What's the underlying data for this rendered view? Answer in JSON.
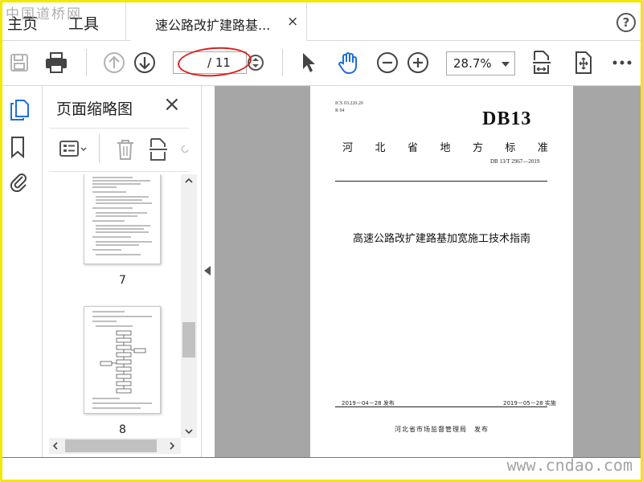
{
  "watermarks": {
    "top": "中国道桥网",
    "bottom": "www.cndao.com"
  },
  "tabs": {
    "home": "主页",
    "tools": "工具",
    "document": "速公路改扩建路基...",
    "close": "×"
  },
  "help": {
    "label": "?"
  },
  "toolbar": {
    "page_current": "",
    "page_total": "/ 11",
    "zoom": "28.7%",
    "icons": [
      "save-icon",
      "print-icon",
      "page-up-icon",
      "page-down-icon",
      "stepper-icon",
      "select-icon",
      "hand-icon",
      "zoom-out-icon",
      "zoom-in-icon",
      "fit-page-icon",
      "scroll-mode-icon",
      "more-icon"
    ]
  },
  "thumbnails_panel": {
    "title": "页面缩略图",
    "close": "×",
    "pages": [
      {
        "number": "7"
      },
      {
        "number": "8"
      }
    ]
  },
  "document": {
    "meta": [
      "ICS 03.220.20",
      "R 04"
    ],
    "standard_prefix": "DB13",
    "province": [
      "河",
      "北",
      "省",
      "地",
      "方",
      "标",
      "准"
    ],
    "code": "DB 13/T 2967—2019",
    "title": "高速公路改扩建路基加宽施工技术指南",
    "release_date": "2019－04－28 发布",
    "implement_date": "2019－05－28 实施",
    "issuer": "河北省市场监督管理局　发布"
  },
  "colors": {
    "frame": "#f5e600",
    "annotation_oval": "#d9231e",
    "viewport_bg": "#a6a6a6",
    "icon_blue": "#1e6fd9"
  }
}
